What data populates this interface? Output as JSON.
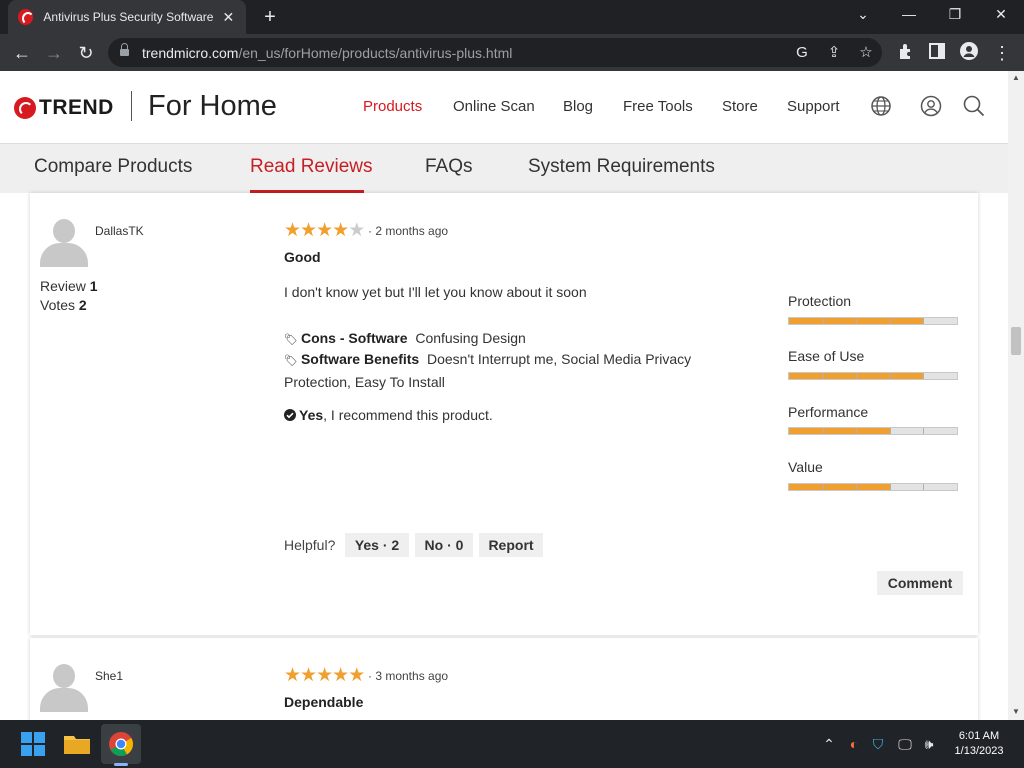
{
  "browser": {
    "tab_title": "Antivirus Plus Security Software |",
    "tab_close": "✕",
    "new_tab": "+",
    "url_host": "trendmicro.com",
    "url_path": "/en_us/forHome/products/antivirus-plus.html"
  },
  "header": {
    "logo_text": "TREND",
    "brand_sub": "For Home",
    "nav": [
      "Products",
      "Online Scan",
      "Blog",
      "Free Tools",
      "Store",
      "Support"
    ]
  },
  "subnav": [
    "Compare Products",
    "Read Reviews",
    "FAQs",
    "System Requirements"
  ],
  "review1": {
    "name": "DallasTK",
    "review_label": "Review",
    "review_count": "1",
    "votes_label": "Votes",
    "votes_count": "2",
    "stars": 4,
    "ago": "· 2 months ago",
    "title": "Good",
    "body": "I don't know yet but I'll let you know about it soon",
    "cons_label": "Cons - Software",
    "cons_value": "Confusing Design",
    "benefits_label": "Software Benefits",
    "benefits_value": "Doesn't Interrupt me,  Social Media Privacy Protection,  Easy To Install",
    "recommend_label": "Yes",
    "recommend_text": ",  I recommend this product.",
    "ratings": [
      {
        "label": "Protection",
        "value": 4,
        "max": 5
      },
      {
        "label": "Ease of Use",
        "value": 4,
        "max": 5
      },
      {
        "label": "Performance",
        "value": 3,
        "max": 5
      },
      {
        "label": "Value",
        "value": 3,
        "max": 5
      }
    ],
    "helpful_label": "Helpful?",
    "yes_btn": "Yes · 2",
    "no_btn": "No · 0",
    "report_btn": "Report",
    "comment_btn": "Comment"
  },
  "review2": {
    "name": "She1",
    "stars": 5,
    "ago": "· 3 months ago",
    "title": "Dependable"
  },
  "taskbar": {
    "time": "6:01 AM",
    "date": "1/13/2023"
  },
  "colors": {
    "accent": "#d71920",
    "star": "#f0a030"
  }
}
